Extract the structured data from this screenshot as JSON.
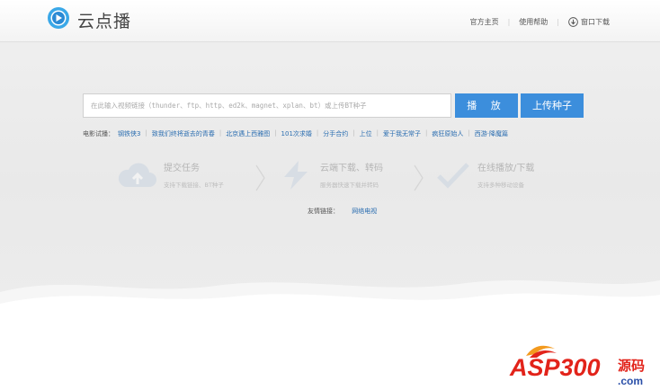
{
  "header": {
    "app_name": "云点播",
    "nav": [
      "官方主页",
      "使用帮助"
    ],
    "download_label": "窗口下载"
  },
  "search": {
    "placeholder": "在此输入视频链接（thunder、ftp、http、ed2k、magnet、xplan、bt）或上传BT种子",
    "play_label": "播 放",
    "upload_label": "上传种子"
  },
  "quick_links": {
    "label": "电影试播：",
    "items": [
      "钢铁侠3",
      "致我们终将逝去的青春",
      "北京遇上西雅图",
      "101次求婚",
      "分手合约",
      "上位",
      "爱于我无常子",
      "疯狂原始人",
      "西游·降魔篇"
    ]
  },
  "steps": [
    {
      "icon": "cloud-upload-icon",
      "title": "提交任务",
      "subtitle": "支持下载链接、BT种子"
    },
    {
      "icon": "lightning-icon",
      "title": "云端下载、转码",
      "subtitle": "服务器快速下载并转码"
    },
    {
      "icon": "checkmark-icon",
      "title": "在线播放/下载",
      "subtitle": "支持多种移动设备"
    }
  ],
  "friend_links": {
    "label": "友情链接：",
    "items": [
      "网络电视"
    ]
  },
  "watermark": {
    "brand": "ASP300",
    "suffix": "源码",
    "domain": ".com"
  },
  "colors": {
    "accent": "#3c8edc",
    "link": "#2a6db0",
    "watermark_red": "#e2231a",
    "watermark_blue": "#2a4fa8"
  }
}
